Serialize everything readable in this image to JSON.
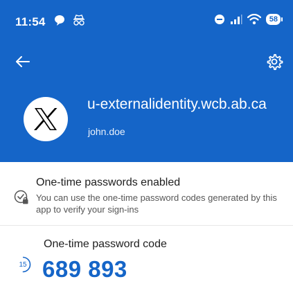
{
  "status_bar": {
    "time": "11:54",
    "battery": "58"
  },
  "colors": {
    "header_bg": "#1565c8",
    "accent": "#1565c8"
  },
  "header": {
    "back_icon": "arrow-left-icon",
    "settings_icon": "gear-icon",
    "account_title": "u-externalidentity.wcb.ab.ca",
    "account_user": "john.doe",
    "avatar_icon": "x-logo-icon"
  },
  "otp_enabled": {
    "title": "One-time passwords enabled",
    "description": "You can use the one-time password codes generated by this app to verify your sign-ins"
  },
  "otp_code": {
    "label": "One-time password code",
    "timer_seconds": "15",
    "code": "689 893"
  }
}
